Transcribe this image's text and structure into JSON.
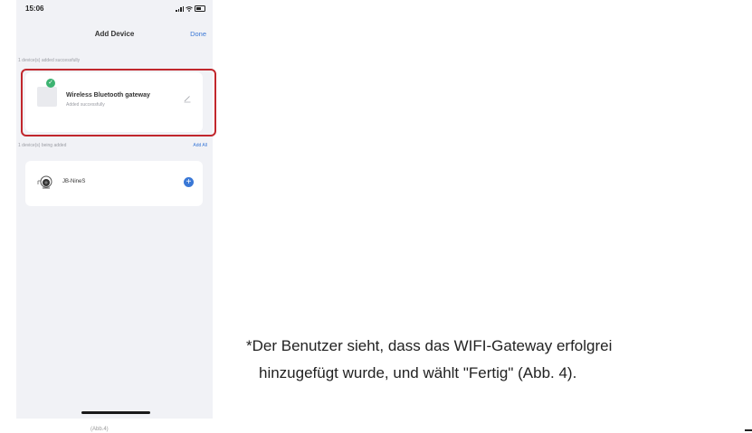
{
  "status_bar": {
    "time": "15:06"
  },
  "nav": {
    "title": "Add Device",
    "done": "Done"
  },
  "added_section": {
    "label": "1 device(s) added successfully",
    "device_name": "Wireless Bluetooth gateway",
    "device_status": "Added successfully"
  },
  "adding_section": {
    "label": "1 device(s) being added",
    "add_all": "Add All",
    "device_name": "JB-NineS"
  },
  "figure_caption": "(Abb.4)",
  "instruction": {
    "line1": "*Der Benutzer sieht, dass das WIFI-Gateway erfolgrei",
    "line2": "hinzugefügt wurde, und wählt \"Fertig\" (Abb. 4)."
  },
  "colors": {
    "accent": "#3a78d6",
    "success": "#3cb371",
    "highlight": "#c1272d"
  }
}
